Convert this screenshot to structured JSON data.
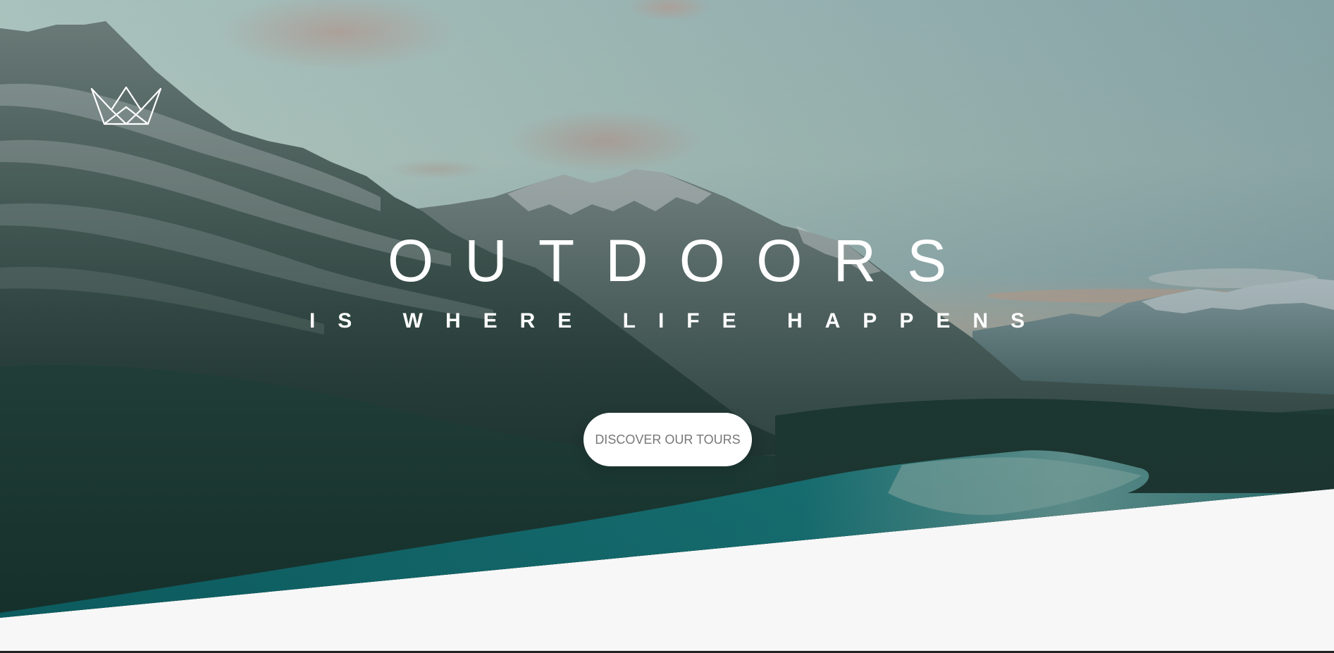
{
  "header": {
    "logo_icon": "crown-outline-icon"
  },
  "hero": {
    "title": "OUTDOORS",
    "subtitle": "IS WHERE LIFE HAPPENS",
    "cta_label": "DISCOVER OUR TOURS",
    "background": "mountain-lake-landscape-image"
  },
  "colors": {
    "sky_top": "#a9c4c2",
    "sky_horizon": "#e8b89a",
    "mountain": "#2f4a45",
    "forest": "#1f3a34",
    "lake": "#0f6f73",
    "page_bg": "#f7f7f7",
    "button_bg": "#ffffff",
    "button_text": "#777777"
  }
}
